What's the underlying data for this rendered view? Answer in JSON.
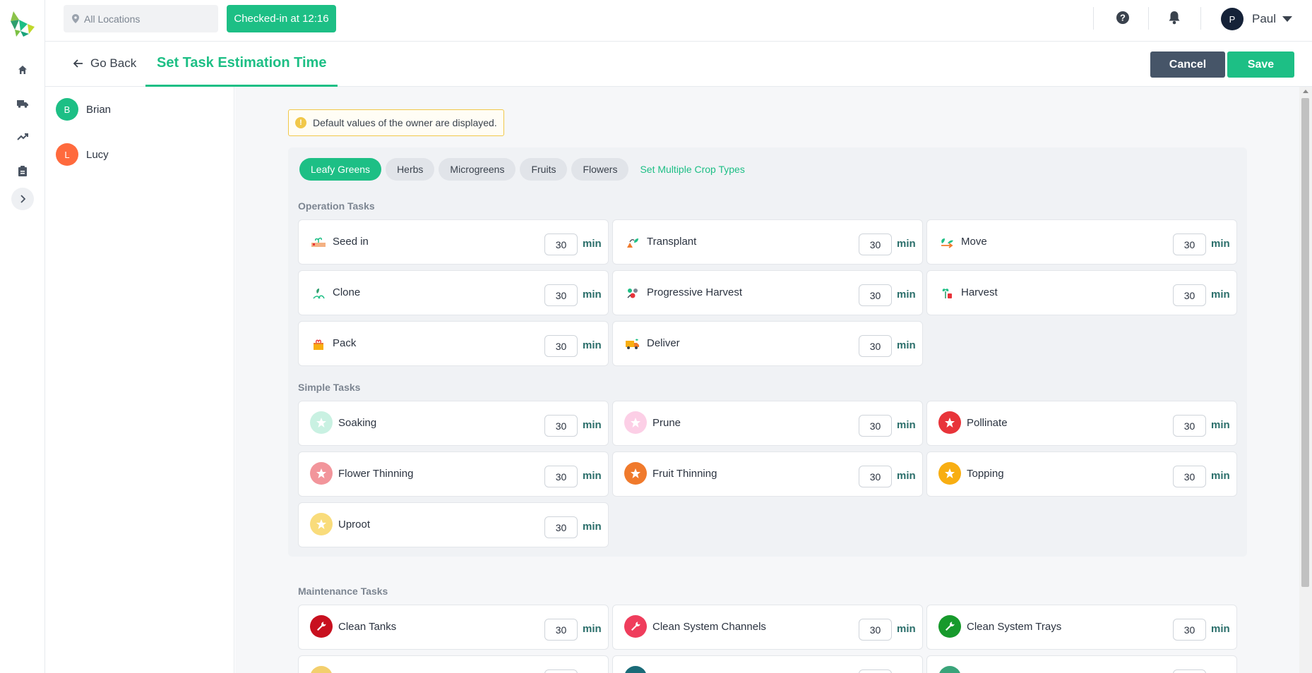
{
  "header": {
    "location_placeholder": "All Locations",
    "checkin_label": "Checked-in at 12:16",
    "user_initial": "P",
    "user_name": "Paul"
  },
  "subheader": {
    "back_label": "Go Back",
    "title": "Set Task Estimation Time",
    "cancel_label": "Cancel",
    "save_label": "Save"
  },
  "people": [
    {
      "initial": "B",
      "name": "Brian",
      "color": "#1dbf85"
    },
    {
      "initial": "L",
      "name": "Lucy",
      "color": "#ff6a3d"
    }
  ],
  "notice": "Default values of the owner are displayed.",
  "crop_tabs": [
    "Leafy Greens",
    "Herbs",
    "Microgreens",
    "Fruits",
    "Flowers"
  ],
  "active_tab": "Leafy Greens",
  "multi_crop_link": "Set Multiple Crop Types",
  "unit": "min",
  "operation": {
    "label": "Operation Tasks",
    "tasks": [
      {
        "name": "Seed in",
        "value": "30",
        "icon": "seed-in-icon"
      },
      {
        "name": "Transplant",
        "value": "30",
        "icon": "transplant-icon"
      },
      {
        "name": "Move",
        "value": "30",
        "icon": "move-icon"
      },
      {
        "name": "Clone",
        "value": "30",
        "icon": "clone-icon"
      },
      {
        "name": "Progressive Harvest",
        "value": "30",
        "icon": "progressive-harvest-icon"
      },
      {
        "name": "Harvest",
        "value": "30",
        "icon": "harvest-icon"
      },
      {
        "name": "Pack",
        "value": "30",
        "icon": "pack-icon"
      },
      {
        "name": "Deliver",
        "value": "30",
        "icon": "deliver-icon"
      }
    ]
  },
  "simple": {
    "label": "Simple Tasks",
    "tasks": [
      {
        "name": "Soaking",
        "value": "30",
        "color": "#c9f1e2",
        "icon": "star-icon"
      },
      {
        "name": "Prune",
        "value": "30",
        "color": "#fccfe6",
        "icon": "star-icon"
      },
      {
        "name": "Pollinate",
        "value": "30",
        "color": "#e8343a",
        "icon": "star-icon"
      },
      {
        "name": "Flower Thinning",
        "value": "30",
        "color": "#f2959b",
        "icon": "star-icon"
      },
      {
        "name": "Fruit Thinning",
        "value": "30",
        "color": "#f07a2c",
        "icon": "star-icon"
      },
      {
        "name": "Topping",
        "value": "30",
        "color": "#f8ae12",
        "icon": "star-icon"
      },
      {
        "name": "Uproot",
        "value": "30",
        "color": "#f9dc7b",
        "icon": "star-icon"
      }
    ]
  },
  "maintenance": {
    "label": "Maintenance Tasks",
    "tasks": [
      {
        "name": "Clean Tanks",
        "value": "30",
        "color": "#c8101f",
        "icon": "wrench-icon"
      },
      {
        "name": "Clean System Channels",
        "value": "30",
        "color": "#ef3d5c",
        "icon": "wrench-icon"
      },
      {
        "name": "Clean System Trays",
        "value": "30",
        "color": "#179a2c",
        "icon": "wrench-icon"
      },
      {
        "name": "",
        "value": "",
        "color": "#f3cf6d",
        "icon": "wrench-icon"
      },
      {
        "name": "",
        "value": "",
        "color": "#1a6b78",
        "icon": "wrench-icon"
      },
      {
        "name": "",
        "value": "",
        "color": "#3aa47a",
        "icon": "wrench-icon"
      }
    ]
  }
}
